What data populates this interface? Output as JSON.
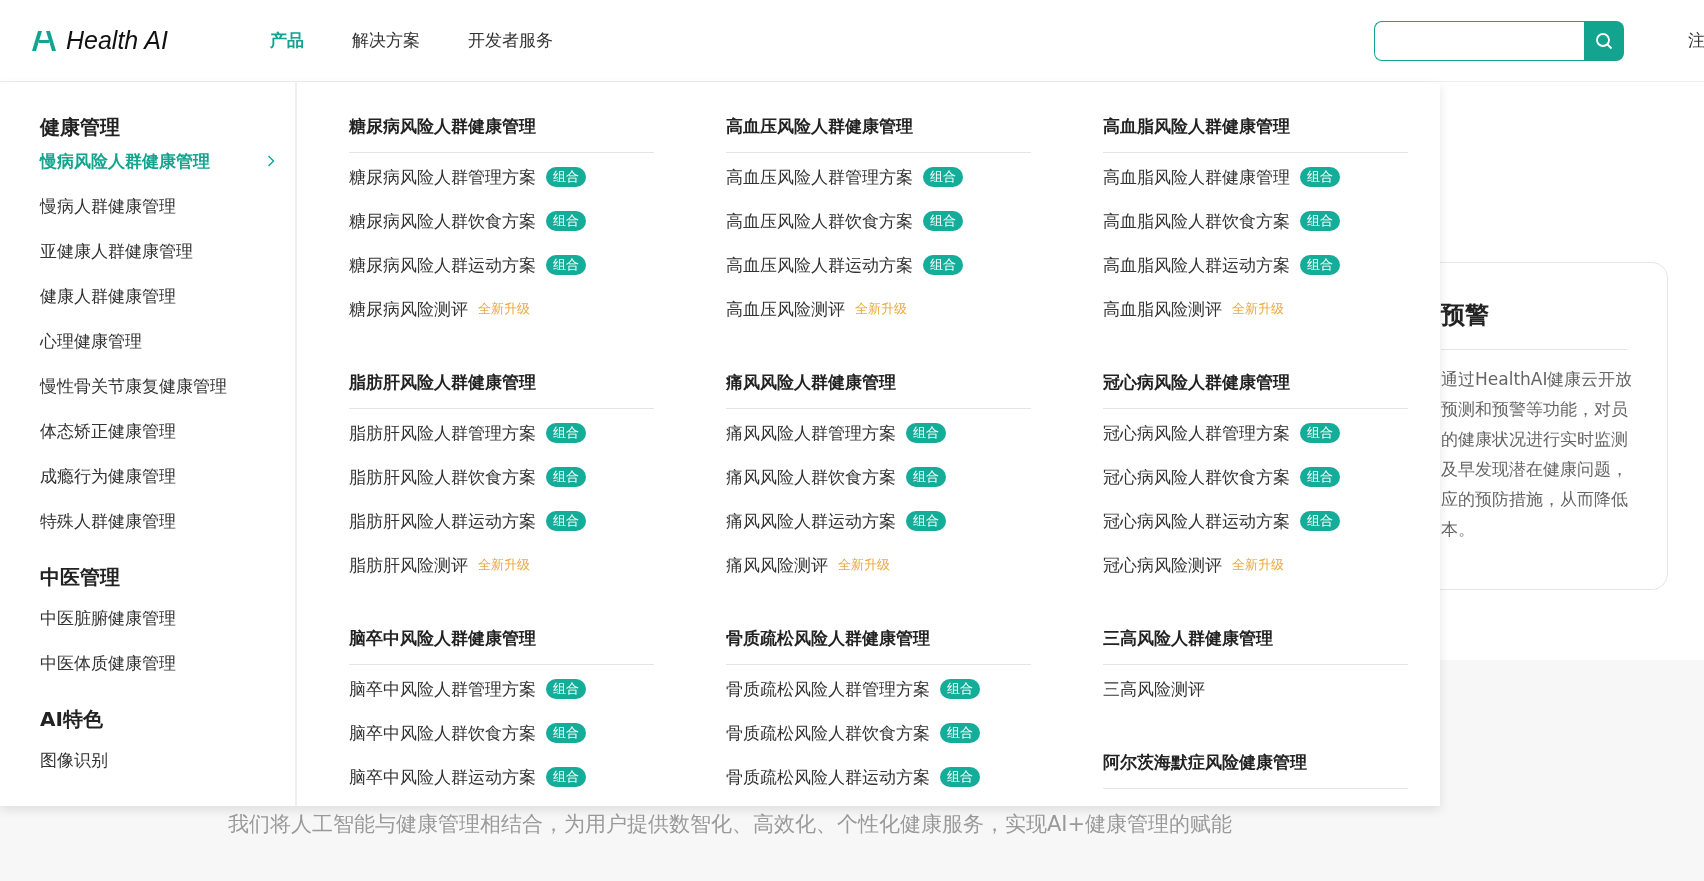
{
  "header": {
    "logo": "Health AI",
    "nav": [
      {
        "label": "产品",
        "selected": true
      },
      {
        "label": "解决方案",
        "selected": false
      },
      {
        "label": "开发者服务",
        "selected": false
      }
    ],
    "edge_link": "注"
  },
  "menu": {
    "sidebar": [
      {
        "title": "健康管理",
        "items": [
          {
            "label": "慢病风险人群健康管理",
            "selected": true
          },
          {
            "label": "慢病人群健康管理",
            "selected": false
          },
          {
            "label": "亚健康人群健康管理",
            "selected": false
          },
          {
            "label": "健康人群健康管理",
            "selected": false
          },
          {
            "label": "心理健康管理",
            "selected": false
          },
          {
            "label": "慢性骨关节康复健康管理",
            "selected": false
          },
          {
            "label": "体态矫正健康管理",
            "selected": false
          },
          {
            "label": "成瘾行为健康管理",
            "selected": false
          },
          {
            "label": "特殊人群健康管理",
            "selected": false
          }
        ]
      },
      {
        "title": "中医管理",
        "items": [
          {
            "label": "中医脏腑健康管理",
            "selected": false
          },
          {
            "label": "中医体质健康管理",
            "selected": false
          }
        ]
      },
      {
        "title": "AI特色",
        "items": [
          {
            "label": "图像识别",
            "selected": false
          }
        ]
      }
    ],
    "columns": [
      [
        {
          "title": "糖尿病风险人群健康管理",
          "items": [
            {
              "label": "糖尿病风险人群管理方案",
              "badge": {
                "kind": "combo",
                "text": "组合"
              }
            },
            {
              "label": "糖尿病风险人群饮食方案",
              "badge": {
                "kind": "combo",
                "text": "组合"
              }
            },
            {
              "label": "糖尿病风险人群运动方案",
              "badge": {
                "kind": "combo",
                "text": "组合"
              }
            },
            {
              "label": "糖尿病风险测评",
              "badge": {
                "kind": "upgrade",
                "text": "全新升级"
              }
            }
          ]
        },
        {
          "title": "脂肪肝风险人群健康管理",
          "items": [
            {
              "label": "脂肪肝风险人群管理方案",
              "badge": {
                "kind": "combo",
                "text": "组合"
              }
            },
            {
              "label": "脂肪肝风险人群饮食方案",
              "badge": {
                "kind": "combo",
                "text": "组合"
              }
            },
            {
              "label": "脂肪肝风险人群运动方案",
              "badge": {
                "kind": "combo",
                "text": "组合"
              }
            },
            {
              "label": "脂肪肝风险测评",
              "badge": {
                "kind": "upgrade",
                "text": "全新升级"
              }
            }
          ]
        },
        {
          "title": "脑卒中风险人群健康管理",
          "items": [
            {
              "label": "脑卒中风险人群管理方案",
              "badge": {
                "kind": "combo",
                "text": "组合"
              }
            },
            {
              "label": "脑卒中风险人群饮食方案",
              "badge": {
                "kind": "combo",
                "text": "组合"
              }
            },
            {
              "label": "脑卒中风险人群运动方案",
              "badge": {
                "kind": "combo",
                "text": "组合"
              }
            }
          ]
        }
      ],
      [
        {
          "title": "高血压风险人群健康管理",
          "items": [
            {
              "label": "高血压风险人群管理方案",
              "badge": {
                "kind": "combo",
                "text": "组合"
              }
            },
            {
              "label": "高血压风险人群饮食方案",
              "badge": {
                "kind": "combo",
                "text": "组合"
              }
            },
            {
              "label": "高血压风险人群运动方案",
              "badge": {
                "kind": "combo",
                "text": "组合"
              }
            },
            {
              "label": "高血压风险测评",
              "badge": {
                "kind": "upgrade",
                "text": "全新升级"
              }
            }
          ]
        },
        {
          "title": "痛风风险人群健康管理",
          "items": [
            {
              "label": "痛风风险人群管理方案",
              "badge": {
                "kind": "combo",
                "text": "组合"
              }
            },
            {
              "label": "痛风风险人群饮食方案",
              "badge": {
                "kind": "combo",
                "text": "组合"
              }
            },
            {
              "label": "痛风风险人群运动方案",
              "badge": {
                "kind": "combo",
                "text": "组合"
              }
            },
            {
              "label": "痛风风险测评",
              "badge": {
                "kind": "upgrade",
                "text": "全新升级"
              }
            }
          ]
        },
        {
          "title": "骨质疏松风险人群健康管理",
          "items": [
            {
              "label": "骨质疏松风险人群管理方案",
              "badge": {
                "kind": "combo",
                "text": "组合"
              }
            },
            {
              "label": "骨质疏松风险人群饮食方案",
              "badge": {
                "kind": "combo",
                "text": "组合"
              }
            },
            {
              "label": "骨质疏松风险人群运动方案",
              "badge": {
                "kind": "combo",
                "text": "组合"
              }
            }
          ]
        }
      ],
      [
        {
          "title": "高血脂风险人群健康管理",
          "items": [
            {
              "label": "高血脂风险人群健康管理",
              "badge": {
                "kind": "combo",
                "text": "组合"
              }
            },
            {
              "label": "高血脂风险人群饮食方案",
              "badge": {
                "kind": "combo",
                "text": "组合"
              }
            },
            {
              "label": "高血脂风险人群运动方案",
              "badge": {
                "kind": "combo",
                "text": "组合"
              }
            },
            {
              "label": "高血脂风险测评",
              "badge": {
                "kind": "upgrade",
                "text": "全新升级"
              }
            }
          ]
        },
        {
          "title": "冠心病风险人群健康管理",
          "items": [
            {
              "label": "冠心病风险人群管理方案",
              "badge": {
                "kind": "combo",
                "text": "组合"
              }
            },
            {
              "label": "冠心病风险人群饮食方案",
              "badge": {
                "kind": "combo",
                "text": "组合"
              }
            },
            {
              "label": "冠心病风险人群运动方案",
              "badge": {
                "kind": "combo",
                "text": "组合"
              }
            },
            {
              "label": "冠心病风险测评",
              "badge": {
                "kind": "upgrade",
                "text": "全新升级"
              }
            }
          ]
        },
        {
          "title": "三高风险人群健康管理",
          "items": [
            {
              "label": "三高风险测评"
            }
          ]
        },
        {
          "title": "阿尔茨海默症风险健康管理"
        }
      ]
    ]
  },
  "card": {
    "title": "预警",
    "lines": [
      "通过HealthAI健康云开放",
      "预测和预警等功能，对员",
      "的健康状况进行实时监测",
      "及早发现潜在健康问题，",
      "应的预防措施，从而降低",
      "本。"
    ]
  },
  "tagline": "我们将人工智能与健康管理相结合，为用户提供数智化、高效化、个性化健康服务，实现AI+健康管理的赋能"
}
